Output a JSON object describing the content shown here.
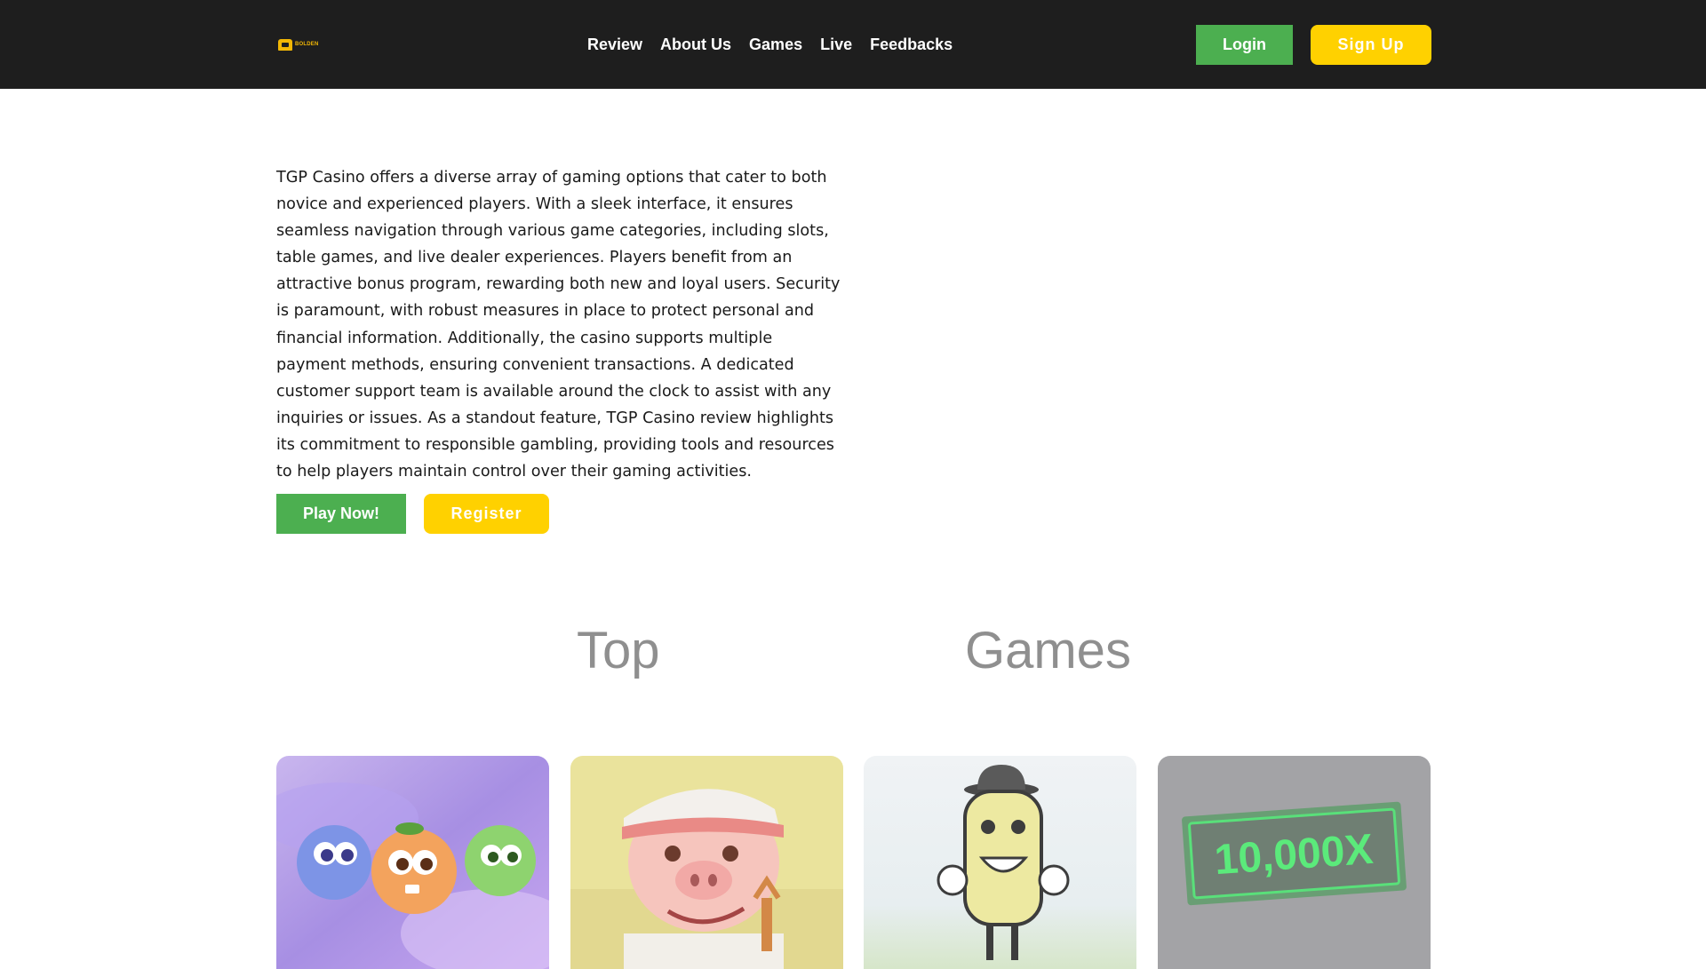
{
  "header": {
    "logo_text": "BOLDEN",
    "nav": [
      "Review",
      "About Us",
      "Games",
      "Live",
      "Feedbacks"
    ],
    "login_label": "Login",
    "signup_label": "Sign Up"
  },
  "hero": {
    "text": "TGP Casino offers a diverse array of gaming options that cater to both novice and experienced players. With a sleek interface, it ensures seamless navigation through various game categories, including slots, table games, and live dealer experiences. Players benefit from an attractive bonus program, rewarding both new and loyal users. Security is paramount, with robust measures in place to protect personal and financial information. Additionally, the casino supports multiple payment methods, ensuring convenient transactions. A dedicated customer support team is available around the clock to assist with any inquiries or issues. As a standout feature, TGP Casino review highlights its commitment to responsible gambling, providing tools and resources to help players maintain control over their gaming activities.",
    "play_label": "Play Now!",
    "register_label": "Register"
  },
  "top_games": {
    "heading_left": "Top",
    "heading_right": "Games",
    "cards": [
      {
        "name": "fruit-characters-game"
      },
      {
        "name": "pig-slingshot-game"
      },
      {
        "name": "bowler-hat-character-game"
      },
      {
        "name": "multiplier-game",
        "banner_text": "10,000X"
      }
    ]
  },
  "colors": {
    "header_bg": "#1e1e1e",
    "green": "#4caf50",
    "yellow": "#ffd100",
    "heading_gray": "#8f8f8f"
  }
}
